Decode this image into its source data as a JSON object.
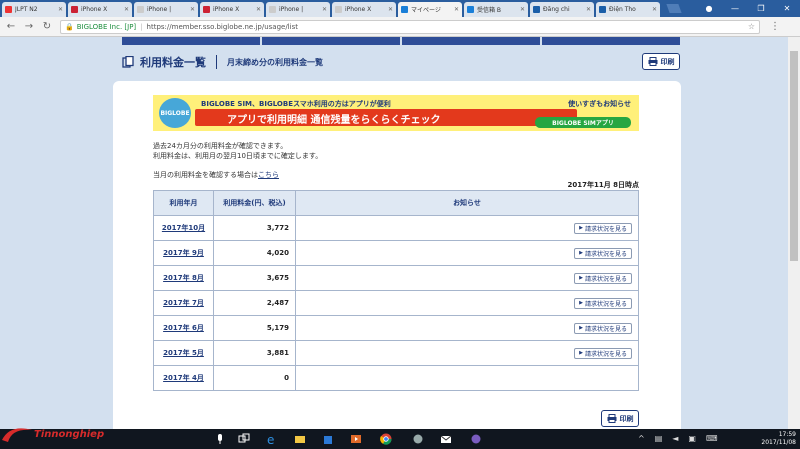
{
  "browser": {
    "tabs": [
      {
        "label": "JLPT N2",
        "color": "#e33"
      },
      {
        "label": "iPhone X",
        "color": "#c23"
      },
      {
        "label": "iPhone |",
        "color": "#ccc"
      },
      {
        "label": "iPhone X",
        "color": "#c23"
      },
      {
        "label": "iPhone |",
        "color": "#ccc"
      },
      {
        "label": "iPhone X",
        "color": "#ccc"
      },
      {
        "label": "マイページ",
        "color": "#1a7fd8",
        "active": true
      },
      {
        "label": "受信箱 B",
        "color": "#1a7fd8"
      },
      {
        "label": "Đăng chi",
        "color": "#1a5ea8"
      },
      {
        "label": "Điện Tho",
        "color": "#1a5ea8"
      }
    ],
    "close_label": "✕",
    "url_org": "BIGLOBE Inc. [JP]",
    "url": "https://member.sso.biglobe.ne.jp/usage/list"
  },
  "header": {
    "title": "利用料金一覧",
    "subtitle": "月末締め分の利用料金一覧",
    "print_label": "印刷"
  },
  "banner": {
    "top_text": "BIGLOBE SIM、BIGLOBEスマホ利用の方はアプリが便利",
    "main_text": "アプリで利用明細 通信残量をらくらくチェック",
    "right_text": "使いすぎもお知らせ",
    "app_label": "BIGLOBE SIMアプリ",
    "logo_text": "BIGLOBE"
  },
  "intro": {
    "line1": "過去24カ月分の利用料金が確認できます。",
    "line2": "利用料金は、利用月の翌月10日頃までに確定します。",
    "current_prefix": "当月の利用料金を確認する場合は",
    "current_link": "こちら",
    "as_of": "2017年11月 8日時点"
  },
  "table": {
    "headers": [
      "利用年月",
      "利用料金(円、税込)",
      "お知らせ"
    ],
    "button_label": "請求状況を見る",
    "rows": [
      {
        "month": "2017年10月",
        "amount": "3,772"
      },
      {
        "month": "2017年 9月",
        "amount": "4,020"
      },
      {
        "month": "2017年 8月",
        "amount": "3,675"
      },
      {
        "month": "2017年 7月",
        "amount": "2,487"
      },
      {
        "month": "2017年 6月",
        "amount": "5,179"
      },
      {
        "month": "2017年 5月",
        "amount": "3,881"
      },
      {
        "month": "2017年 4月",
        "amount": "0"
      }
    ]
  },
  "footer": {
    "print_label": "印刷"
  },
  "taskbar": {
    "watermark": "Tinnonghiep",
    "time": "17:59",
    "date": "2017/11/08"
  }
}
